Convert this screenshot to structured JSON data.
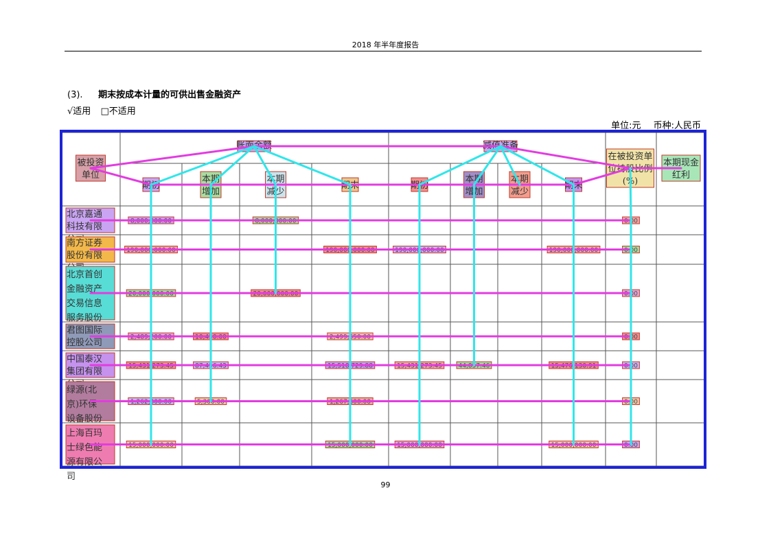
{
  "header": {
    "title": "2018 年半年度报告"
  },
  "section": {
    "number": "(3).",
    "title": "期末按成本计量的可供出售金融资产"
  },
  "applicability": {
    "applicable": "√适用",
    "not_applicable": "□不适用"
  },
  "units": {
    "unit": "单位:元",
    "currency": "币种:人民币"
  },
  "table": {
    "headers": {
      "investee": "被投资单位",
      "book_balance": "账面余额",
      "impairment": "减值准备",
      "shareholding": "在被投资单位持股比例(%)",
      "cash_dividend": "本期现金红利",
      "sub": [
        "期初",
        "本期增加",
        "本期减少",
        "期末",
        "期初",
        "本期增加",
        "本期减少",
        "期末"
      ]
    },
    "rows": [
      {
        "name": "北京嘉通科技有限公司",
        "cells": [
          "8,000,000.00",
          "",
          "8,000,000.00",
          "",
          "",
          "",
          "",
          "",
          "0.00",
          ""
        ]
      },
      {
        "name": "南方证券股份有限公司",
        "cells": [
          "190,000,000.00",
          "",
          "",
          "190,000,000.00",
          "190,000,000.00",
          "",
          "",
          "190,000,000.00",
          "0.00",
          ""
        ]
      },
      {
        "name": "北京首创金融资产交易信息服务股份有限公司",
        "cells": [
          "20,000,000.00",
          "",
          "20,000,000.00",
          "",
          "",
          "",
          "",
          "",
          "0.00",
          ""
        ]
      },
      {
        "name": "君图国际控股公司",
        "cells": [
          "2,489,200.00",
          "10,450.00",
          "",
          "2,499,650.00",
          "",
          "",
          "",
          "",
          "0.00",
          ""
        ]
      },
      {
        "name": "中国泰汉集团有限公司",
        "cells": [
          "15,431,273.45",
          "87,456.43",
          "",
          "15,518,729.88",
          "15,431,273.45",
          "44,857.46",
          "",
          "15,476,130.91",
          "0.00",
          ""
        ]
      },
      {
        "name": "绿源(北京)环保设备股份有限公司",
        "cells": [
          "1,262,300.00",
          "5,300.00",
          "",
          "1,267,600.00",
          "",
          "",
          "",
          "",
          "0.00",
          ""
        ]
      },
      {
        "name": "上海百玛士绿色能源有限公司",
        "cells": [
          "15,000,000.00",
          "",
          "",
          "15,000,000.00",
          "15,000,000.00",
          "",
          "",
          "15,000,000.00",
          "0.00",
          ""
        ]
      }
    ]
  },
  "page_number": "99"
}
